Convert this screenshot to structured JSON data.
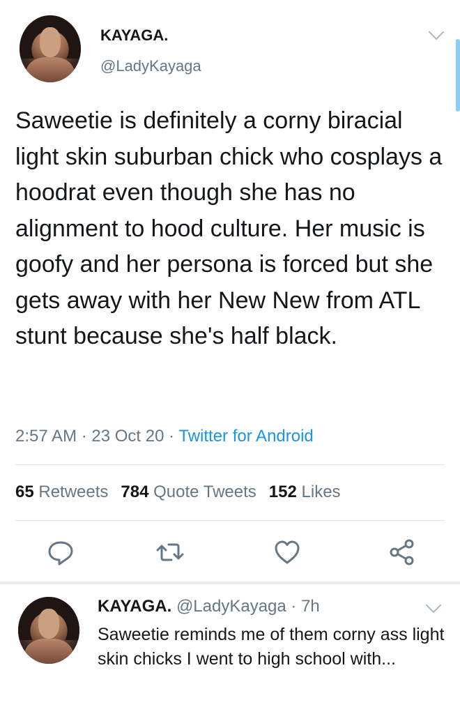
{
  "tweet": {
    "display_name": "KAYAGA.",
    "handle": "@LadyKayaga",
    "text": "Saweetie is definitely a corny biracial light skin suburban chick who cosplays a hoodrat even though she has no alignment to hood culture. Her music is goofy and her persona is forced but she gets away with her New New from ATL stunt because she's half black.",
    "time": "2:57 AM",
    "date": "23 Oct 20",
    "source": "Twitter for Android",
    "separator": " · "
  },
  "stats": {
    "retweets_count": "65",
    "retweets_label": "Retweets",
    "quotes_count": "784",
    "quotes_label": "Quote Tweets",
    "likes_count": "152",
    "likes_label": "Likes"
  },
  "actions": [
    "reply-icon",
    "retweet-icon",
    "like-icon",
    "share-icon"
  ],
  "reply": {
    "display_name": "KAYAGA.",
    "handle": "@LadyKayaga",
    "age": "7h",
    "separator": " · ",
    "text": "Saweetie reminds me of them corny ass light skin chicks I went to high school with..."
  },
  "colors": {
    "primary_text": "#14171a",
    "secondary_text": "#657786",
    "link": "#1b95e0",
    "divider": "#e1e8ed",
    "icon": "#657786"
  }
}
